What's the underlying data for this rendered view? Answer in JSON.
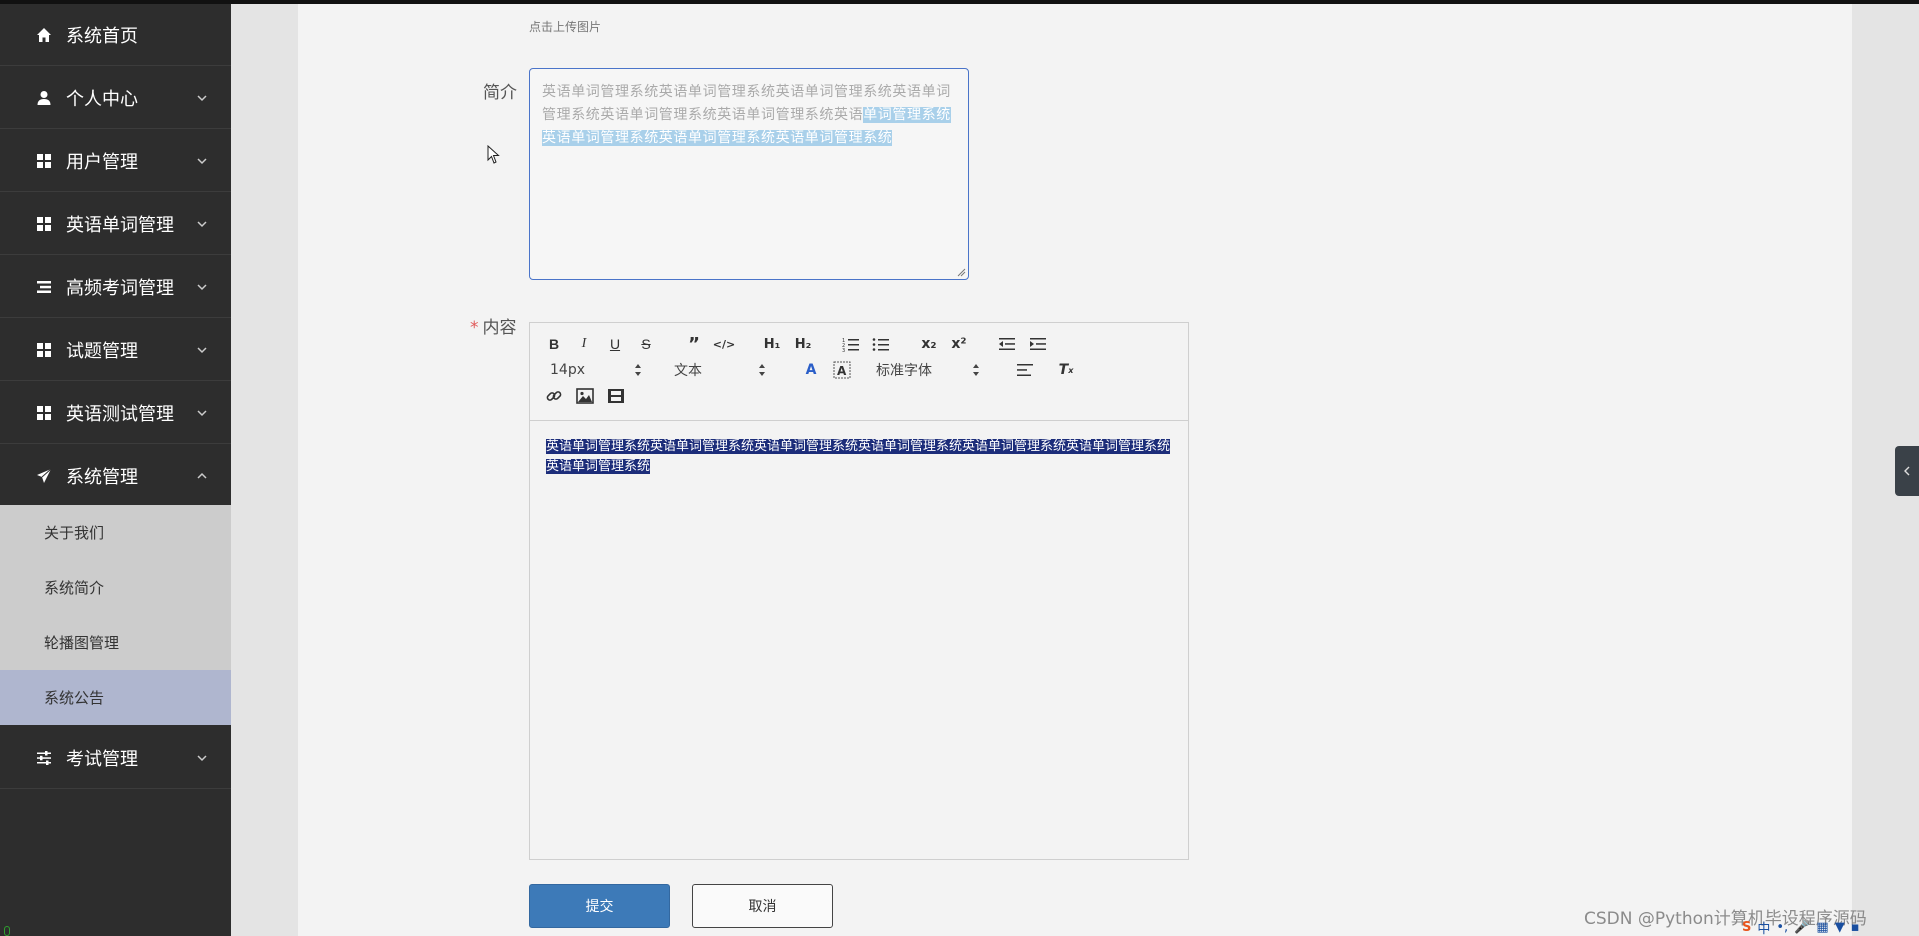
{
  "sidebar": {
    "items": [
      {
        "label": "系统首页",
        "icon": "home-icon",
        "has_chevron": false
      },
      {
        "label": "个人中心",
        "icon": "user-icon",
        "has_chevron": true
      },
      {
        "label": "用户管理",
        "icon": "grid-icon",
        "has_chevron": true
      },
      {
        "label": "英语单词管理",
        "icon": "grid-icon",
        "has_chevron": true
      },
      {
        "label": "高频考词管理",
        "icon": "list-icon",
        "has_chevron": true
      },
      {
        "label": "试题管理",
        "icon": "grid-icon",
        "has_chevron": true
      },
      {
        "label": "英语测试管理",
        "icon": "grid-icon",
        "has_chevron": true
      },
      {
        "label": "系统管理",
        "icon": "paper-plane-icon",
        "has_chevron": true,
        "expanded": true
      },
      {
        "label": "考试管理",
        "icon": "sliders-icon",
        "has_chevron": true
      }
    ],
    "submenu": [
      {
        "label": "关于我们"
      },
      {
        "label": "系统简介"
      },
      {
        "label": "轮播图管理"
      },
      {
        "label": "系统公告",
        "active": true
      }
    ]
  },
  "form": {
    "upload_hint": "点击上传图片",
    "intro_label": "简介",
    "intro_text_plain": "英语单词管理系统英语单词管理系统英语单词管理系统英语单词管理系统英语单词管理系统英语单词管理系统英语",
    "intro_text_selected": "单词管理系统英语单词管理系统英语单词管理系统英语单词管理系统",
    "content_label": "内容",
    "required_mark": "*",
    "content_text": "英语单词管理系统英语单词管理系统英语单词管理系统英语单词管理系统英语单词管理系统英语单词管理系统英语单词管理系统",
    "submit_label": "提交",
    "cancel_label": "取消"
  },
  "toolbar": {
    "font_size": "14px",
    "header_select": "文本",
    "font_family": "标准字体",
    "buttons": [
      "bold-icon",
      "italic-icon",
      "underline-icon",
      "strike-icon",
      "blockquote-icon",
      "code-block-icon",
      "h1-icon",
      "h2-icon",
      "ordered-list-icon",
      "bullet-list-icon",
      "subscript-icon",
      "superscript-icon",
      "outdent-icon",
      "indent-icon",
      "font-color-icon",
      "background-color-icon",
      "align-icon",
      "clean-format-icon",
      "link-icon",
      "image-icon",
      "video-icon"
    ]
  },
  "watermark": "CSDN @Python计算机毕设程序源码",
  "tray": {
    "ime": "中"
  },
  "colors": {
    "sidebar_bg": "#2d2d2d",
    "submenu_bg": "#cccccc",
    "submenu_active": "#afb6cf",
    "primary_button": "#3d7ab8",
    "selection": "#1c2d7a"
  }
}
